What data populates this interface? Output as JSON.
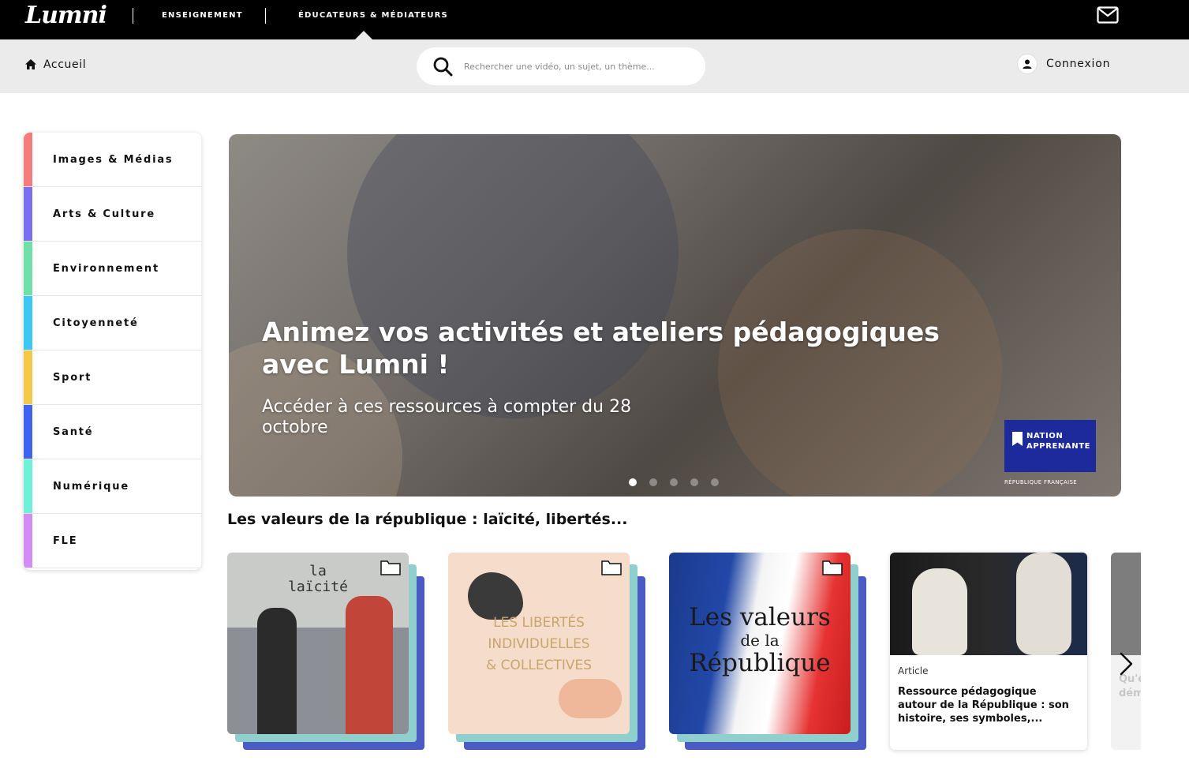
{
  "brand": {
    "logo": "Lumni"
  },
  "topnav": {
    "items": [
      "ENSEIGNEMENT",
      "ÉDUCATEURS & MÉDIATEURS"
    ]
  },
  "subheader": {
    "home_label": "Accueil",
    "search_placeholder": "Rechercher une vidéo, un sujet, un thème...",
    "login_label": "Connexion"
  },
  "categories": [
    {
      "label": "Images & Médias",
      "color": "#f47c7c"
    },
    {
      "label": "Arts & Culture",
      "color": "#7b6ff0"
    },
    {
      "label": "Environnement",
      "color": "#6fe0a8"
    },
    {
      "label": "Citoyenneté",
      "color": "#3cc8f0"
    },
    {
      "label": "Sport",
      "color": "#f6c84a"
    },
    {
      "label": "Santé",
      "color": "#3f63f0"
    },
    {
      "label": "Numérique",
      "color": "#6ff0d8"
    },
    {
      "label": "FLE",
      "color": "#d48cf5"
    }
  ],
  "hero": {
    "title": "Animez vos activités et ateliers pédagogiques avec Lumni !",
    "subtitle": "Accéder à ces ressources à compter du 28 octobre",
    "slide_count": 5,
    "active_slide": 1,
    "badge": {
      "line1": "NATION",
      "line2": "APPRENANTE",
      "footer": "RÉPUBLIQUE FRANÇAISE"
    }
  },
  "section": {
    "title": "Les valeurs de la république : laïcité, libertés...",
    "cards": [
      {
        "text1": "la",
        "text2": "laïcité"
      },
      {
        "text1": "LES LIBERTÉS",
        "text2": "INDIVIDUELLES",
        "text3": "& COLLECTIVES"
      },
      {
        "text1": "Les valeurs",
        "text2": "de la",
        "text3": "République"
      }
    ],
    "article": {
      "type": "Article",
      "title": "Ressource pédagogique autour de la République : son histoire, ses symboles,..."
    },
    "peek_text": [
      "Qu'e",
      "dém"
    ]
  },
  "colors": {
    "topbar": "#000000",
    "subbar": "#ebebeb",
    "stack_teal": "#8fd0cf",
    "stack_blue": "#4a5bc2"
  }
}
